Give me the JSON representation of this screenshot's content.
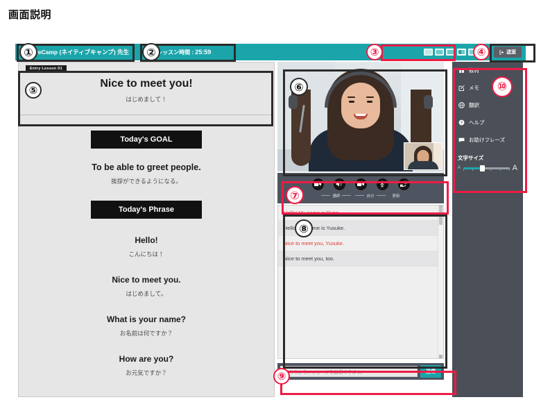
{
  "page": {
    "title": "画面説明"
  },
  "header": {
    "teacher_name": "NativeCamp (ネイティブキャンプ) 先生",
    "lesson_time_label": "レッスン時間 :",
    "lesson_time_value": "25:59",
    "exit_button": "退室",
    "layout_icons": [
      "layout-single-icon",
      "layout-stacked-icon",
      "layout-sidebar-left-icon",
      "layout-split-icon",
      "layout-thumbnail-icon",
      "layout-two-column-icon"
    ]
  },
  "material": {
    "lesson_badge": "Entry Lesson 01",
    "title": "Nice to meet you!",
    "subtitle": "はじめまして！",
    "goal_button": "Today's GOAL",
    "goal_en": "To be able to greet people.",
    "goal_ja": "挨拶ができるようになる。",
    "phrase_button": "Today's Phrase",
    "phrases": [
      {
        "en": "Hello!",
        "ja": "こんにちは！"
      },
      {
        "en": "Nice to meet you.",
        "ja": "はじめまして。"
      },
      {
        "en": "What is your name?",
        "ja": "お名前は何ですか？"
      },
      {
        "en": "How are you?",
        "ja": "お元気ですか？"
      }
    ]
  },
  "controls": {
    "buttons": [
      {
        "icon": "video-camera-icon",
        "name": "teacher-video-button"
      },
      {
        "icon": "speaker-icon",
        "name": "teacher-audio-button"
      },
      {
        "icon": "video-camera-icon",
        "name": "self-video-button"
      },
      {
        "icon": "microphone-icon",
        "name": "self-mic-button"
      },
      {
        "icon": "refresh-icon",
        "name": "refresh-button"
      }
    ],
    "label_teacher": "講師",
    "label_self": "自分",
    "label_refresh": "更新"
  },
  "chat": {
    "messages": [
      {
        "text": "Hello! My name is Ryan.",
        "from": "teacher"
      },
      {
        "text": "Hello! My name is Yusuke.",
        "from": "student"
      },
      {
        "text": "Nice to meet you, Yusuke.",
        "from": "teacher"
      },
      {
        "text": "Nice to meet you, too.",
        "from": "student"
      }
    ],
    "input_placeholder": "こちらからメッセージを送信できます。",
    "send_button": "送信"
  },
  "sidebar": {
    "items": [
      {
        "label": "教材",
        "icon": "book-icon"
      },
      {
        "label": "メモ",
        "icon": "pencil-square-icon"
      },
      {
        "label": "翻訳",
        "icon": "globe-icon"
      },
      {
        "label": "ヘルプ",
        "icon": "question-circle-icon"
      },
      {
        "label": "お助けフレーズ",
        "icon": "chat-bubble-icon"
      }
    ],
    "font_size_label": "文字サイズ",
    "font_size_small": "A",
    "font_size_large": "A",
    "font_size_value": 40
  },
  "annotations": {
    "markers": [
      {
        "n": "①",
        "target": "teacher-name"
      },
      {
        "n": "②",
        "target": "lesson-timer"
      },
      {
        "n": "③",
        "target": "layout-icons"
      },
      {
        "n": "④",
        "target": "exit-button"
      },
      {
        "n": "⑤",
        "target": "material-header"
      },
      {
        "n": "⑥",
        "target": "video-area"
      },
      {
        "n": "⑦",
        "target": "control-bar"
      },
      {
        "n": "⑧",
        "target": "chat-list"
      },
      {
        "n": "⑨",
        "target": "message-input-row"
      },
      {
        "n": "⑩",
        "target": "right-sidebar"
      }
    ]
  },
  "colors": {
    "brand_teal": "#1ba5aa",
    "annotation_red": "#ed1c45",
    "annotation_black": "#2b2b2b",
    "teacher_text": "#e03b2f",
    "panel_dark": "#4b5058"
  }
}
